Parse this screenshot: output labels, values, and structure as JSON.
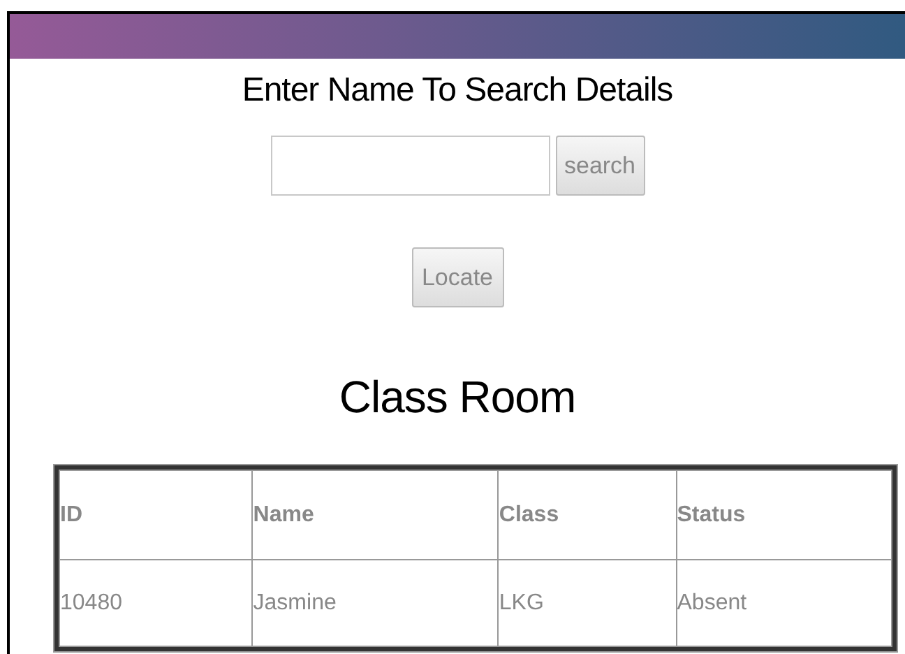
{
  "heading": "Enter Name To Search Details",
  "search": {
    "button": "search"
  },
  "locate_button": "Locate",
  "section_title": "Class Room",
  "table": {
    "columns": [
      "ID",
      "Name",
      "Class",
      "Status"
    ],
    "rows": [
      [
        "10480",
        "Jasmine",
        "LKG",
        "Absent"
      ]
    ]
  }
}
